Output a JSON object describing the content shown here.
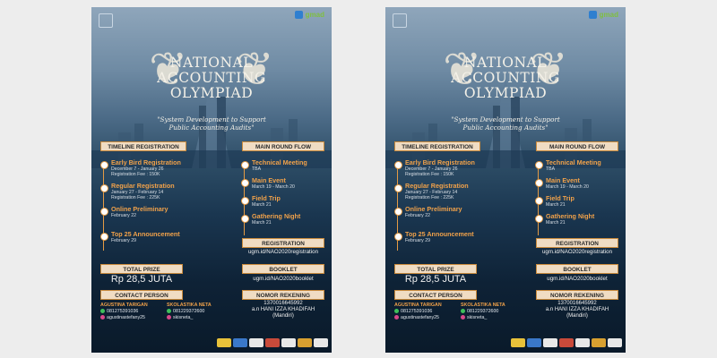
{
  "logos": {
    "right_text": "gmad"
  },
  "title_lines": [
    "NATIONAL",
    "ACCOUNTING",
    "OLYMPIAD"
  ],
  "subtitle_lines": [
    "\"System Development to Support",
    "Public Accounting Audits\""
  ],
  "timeline": {
    "header": "TIMELINE REGISTRATION",
    "items": [
      {
        "head": "Early Bird Registration",
        "lines": [
          "December 7 - January 26",
          "Registration Fee : 150K"
        ]
      },
      {
        "head": "Regular Registration",
        "lines": [
          "January 27 - February 14",
          "Registration Fee : 225K"
        ]
      },
      {
        "head": "Online Preliminary",
        "lines": [
          "February 22"
        ]
      },
      {
        "head": "Top 25 Announcement",
        "lines": [
          "February 29"
        ]
      }
    ]
  },
  "flow": {
    "header": "MAIN ROUND FLOW",
    "items": [
      {
        "head": "Technical Meeting",
        "lines": [
          "TBA"
        ]
      },
      {
        "head": "Main Event",
        "lines": [
          "March 19 - March 20"
        ]
      },
      {
        "head": "Field Trip",
        "lines": [
          "March 21"
        ]
      },
      {
        "head": "Gathering Night",
        "lines": [
          "March 21"
        ]
      }
    ]
  },
  "registration": {
    "header": "REGISTRATION",
    "value": "ugm.id/NAO2020registration"
  },
  "booklet": {
    "header": "BOOKLET",
    "value": "ugm.id/NAO2020booklet"
  },
  "rekening": {
    "header": "NOMOR REKENING",
    "number": "1370016645992",
    "name": "a.n HANI IZZA KHADIFAH",
    "bank": "(Mandiri)"
  },
  "prize": {
    "header": "TOTAL PRIZE",
    "value": "Rp 28,5 JUTA"
  },
  "contact": {
    "header": "CONTACT PERSON",
    "people": [
      {
        "name": "AGUSTINA TARIGAN",
        "phone": "081275391036",
        "ig": "agustinastefany25"
      },
      {
        "name": "SKOLASTIKA NETA",
        "phone": "081229372600",
        "ig": "skisneta_"
      }
    ]
  },
  "colors": {
    "accent": "#e39a44",
    "box_fill": "#f0dcc3"
  }
}
